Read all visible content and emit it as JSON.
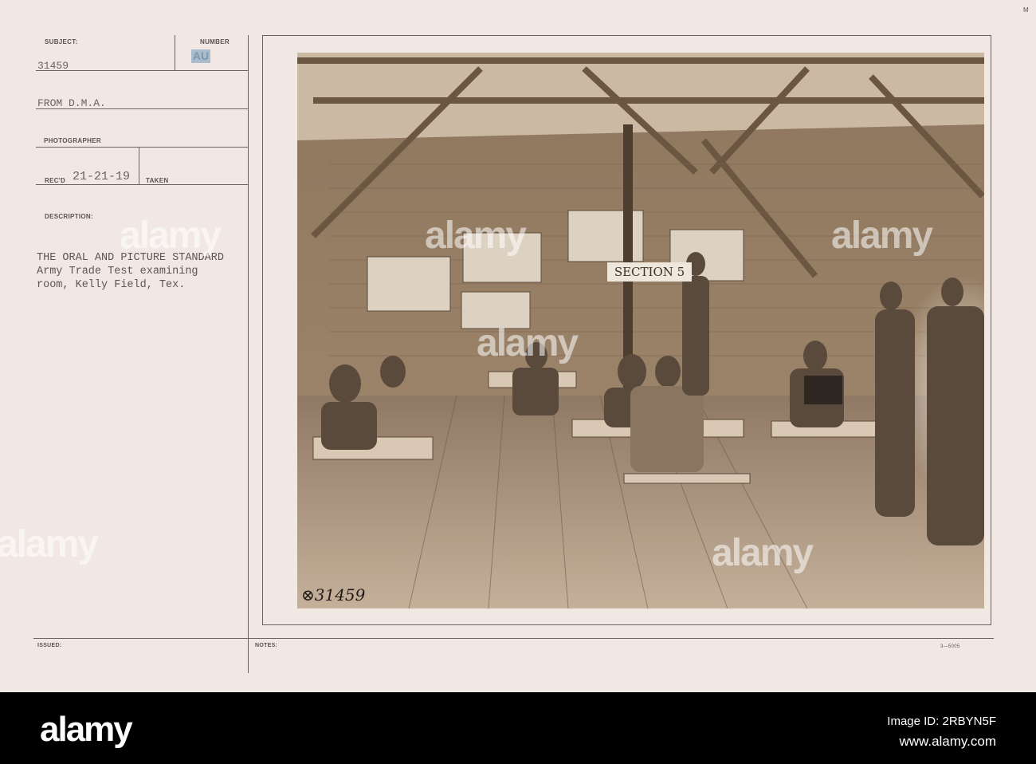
{
  "card": {
    "subject_label": "SUBJECT:",
    "subject_value": "31459",
    "number_label": "NUMBER",
    "number_stamp": "AU",
    "from_value": "FROM D.M.A.",
    "photographer_label": "PHOTOGRAPHER",
    "recd_label": "REC'D",
    "recd_value": "21-21-19",
    "taken_label": "TAKEN",
    "description_label": "DESCRIPTION:",
    "description_lines": [
      "THE ORAL AND PICTURE STANDARD",
      "Army Trade Test examining",
      "room, Kelly Field, Tex."
    ],
    "issued_label": "ISSUED:",
    "notes_label": "NOTES:",
    "form_number": "3—5005",
    "corner_mark": "M"
  },
  "photo": {
    "handwritten_number": "⊗31459",
    "sign_text": "SECTION 5"
  },
  "watermark": {
    "text": "alamy",
    "image_id": "Image ID: 2RBYN5F",
    "url": "www.alamy.com"
  }
}
